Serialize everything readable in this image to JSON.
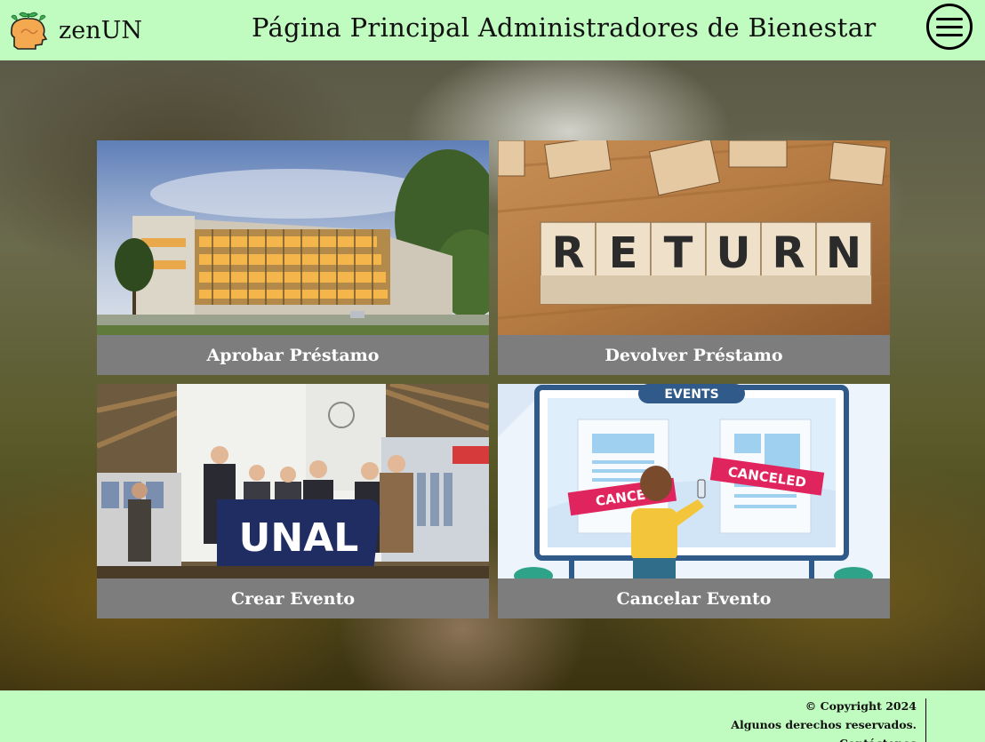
{
  "header": {
    "brand_name": "zenUN",
    "page_title": "Página Principal Administradores de Bienestar"
  },
  "cards": [
    {
      "label": "Aprobar Préstamo",
      "image": "university-building-photo"
    },
    {
      "label": "Devolver Préstamo",
      "image": "return-wooden-blocks-photo"
    },
    {
      "label": "Crear Evento",
      "image": "unal-booth-group-photo"
    },
    {
      "label": "Cancelar Evento",
      "image": "events-canceled-illustration"
    }
  ],
  "images": {
    "return_word": "RETURN",
    "unal_sign": "UNAL",
    "events_banner": "EVENTS",
    "canceled_sticker": "CANCELED",
    "canceled_sticker_partial": "CANCE"
  },
  "footer": {
    "copyright": "© Copyright 2024",
    "rights": "Algunos derechos reservados.",
    "contact": "Contáctenos"
  },
  "colors": {
    "header_bg": "#c0fbbf",
    "card_label_bg": "#7d7d7d",
    "card_label_text": "#ffffff"
  }
}
